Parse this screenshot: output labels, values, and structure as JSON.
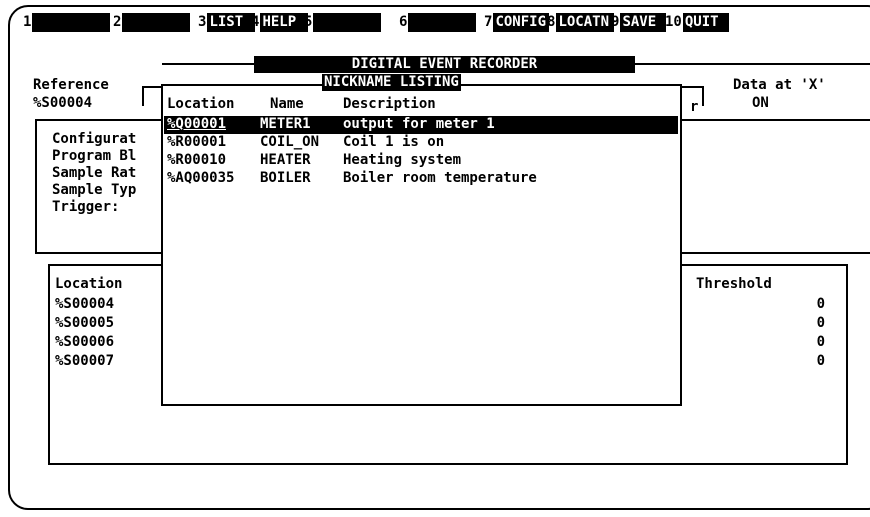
{
  "function_keys": [
    {
      "num": "1",
      "label": ""
    },
    {
      "num": "2",
      "label": ""
    },
    {
      "num": "3",
      "label": "LIST"
    },
    {
      "num": "4",
      "label": "HELP"
    },
    {
      "num": "5",
      "label": ""
    },
    {
      "num": "6",
      "label": ""
    },
    {
      "num": "7",
      "label": "CONFIG"
    },
    {
      "num": "8",
      "label": "LOCATN"
    },
    {
      "num": "9",
      "label": "SAVE"
    },
    {
      "num": "10",
      "label": "QUIT"
    }
  ],
  "title": "DIGITAL EVENT RECORDER",
  "reference": {
    "label": "Reference",
    "value": "%S00004"
  },
  "data_at": {
    "label": "Data at 'X'",
    "value": "ON"
  },
  "config_labels": [
    "Configurat",
    "Program Bl",
    "Sample Rat",
    "Sample Typ",
    "Trigger:"
  ],
  "location_table": {
    "location_header": "Location",
    "threshold_header": "Threshold",
    "rows": [
      {
        "location": "%S00004",
        "threshold": "0"
      },
      {
        "location": "%S00005",
        "threshold": "0"
      },
      {
        "location": "%S00006",
        "threshold": "0"
      },
      {
        "location": "%S00007",
        "threshold": "0"
      }
    ]
  },
  "popup": {
    "title": "NICKNAME LISTING",
    "headers": {
      "location": "Location",
      "name": "Name",
      "description": "Description"
    },
    "rows": [
      {
        "location": "%Q00001",
        "name": "METER1",
        "description": "output for meter 1"
      },
      {
        "location": "%R00001",
        "name": "COIL_ON",
        "description": "Coil 1 is on"
      },
      {
        "location": "%R00010",
        "name": "HEATER",
        "description": "Heating system"
      },
      {
        "location": "%AQ00035",
        "name": "BOILER",
        "description": "Boiler room temperature"
      }
    ],
    "selected_index": 0
  }
}
